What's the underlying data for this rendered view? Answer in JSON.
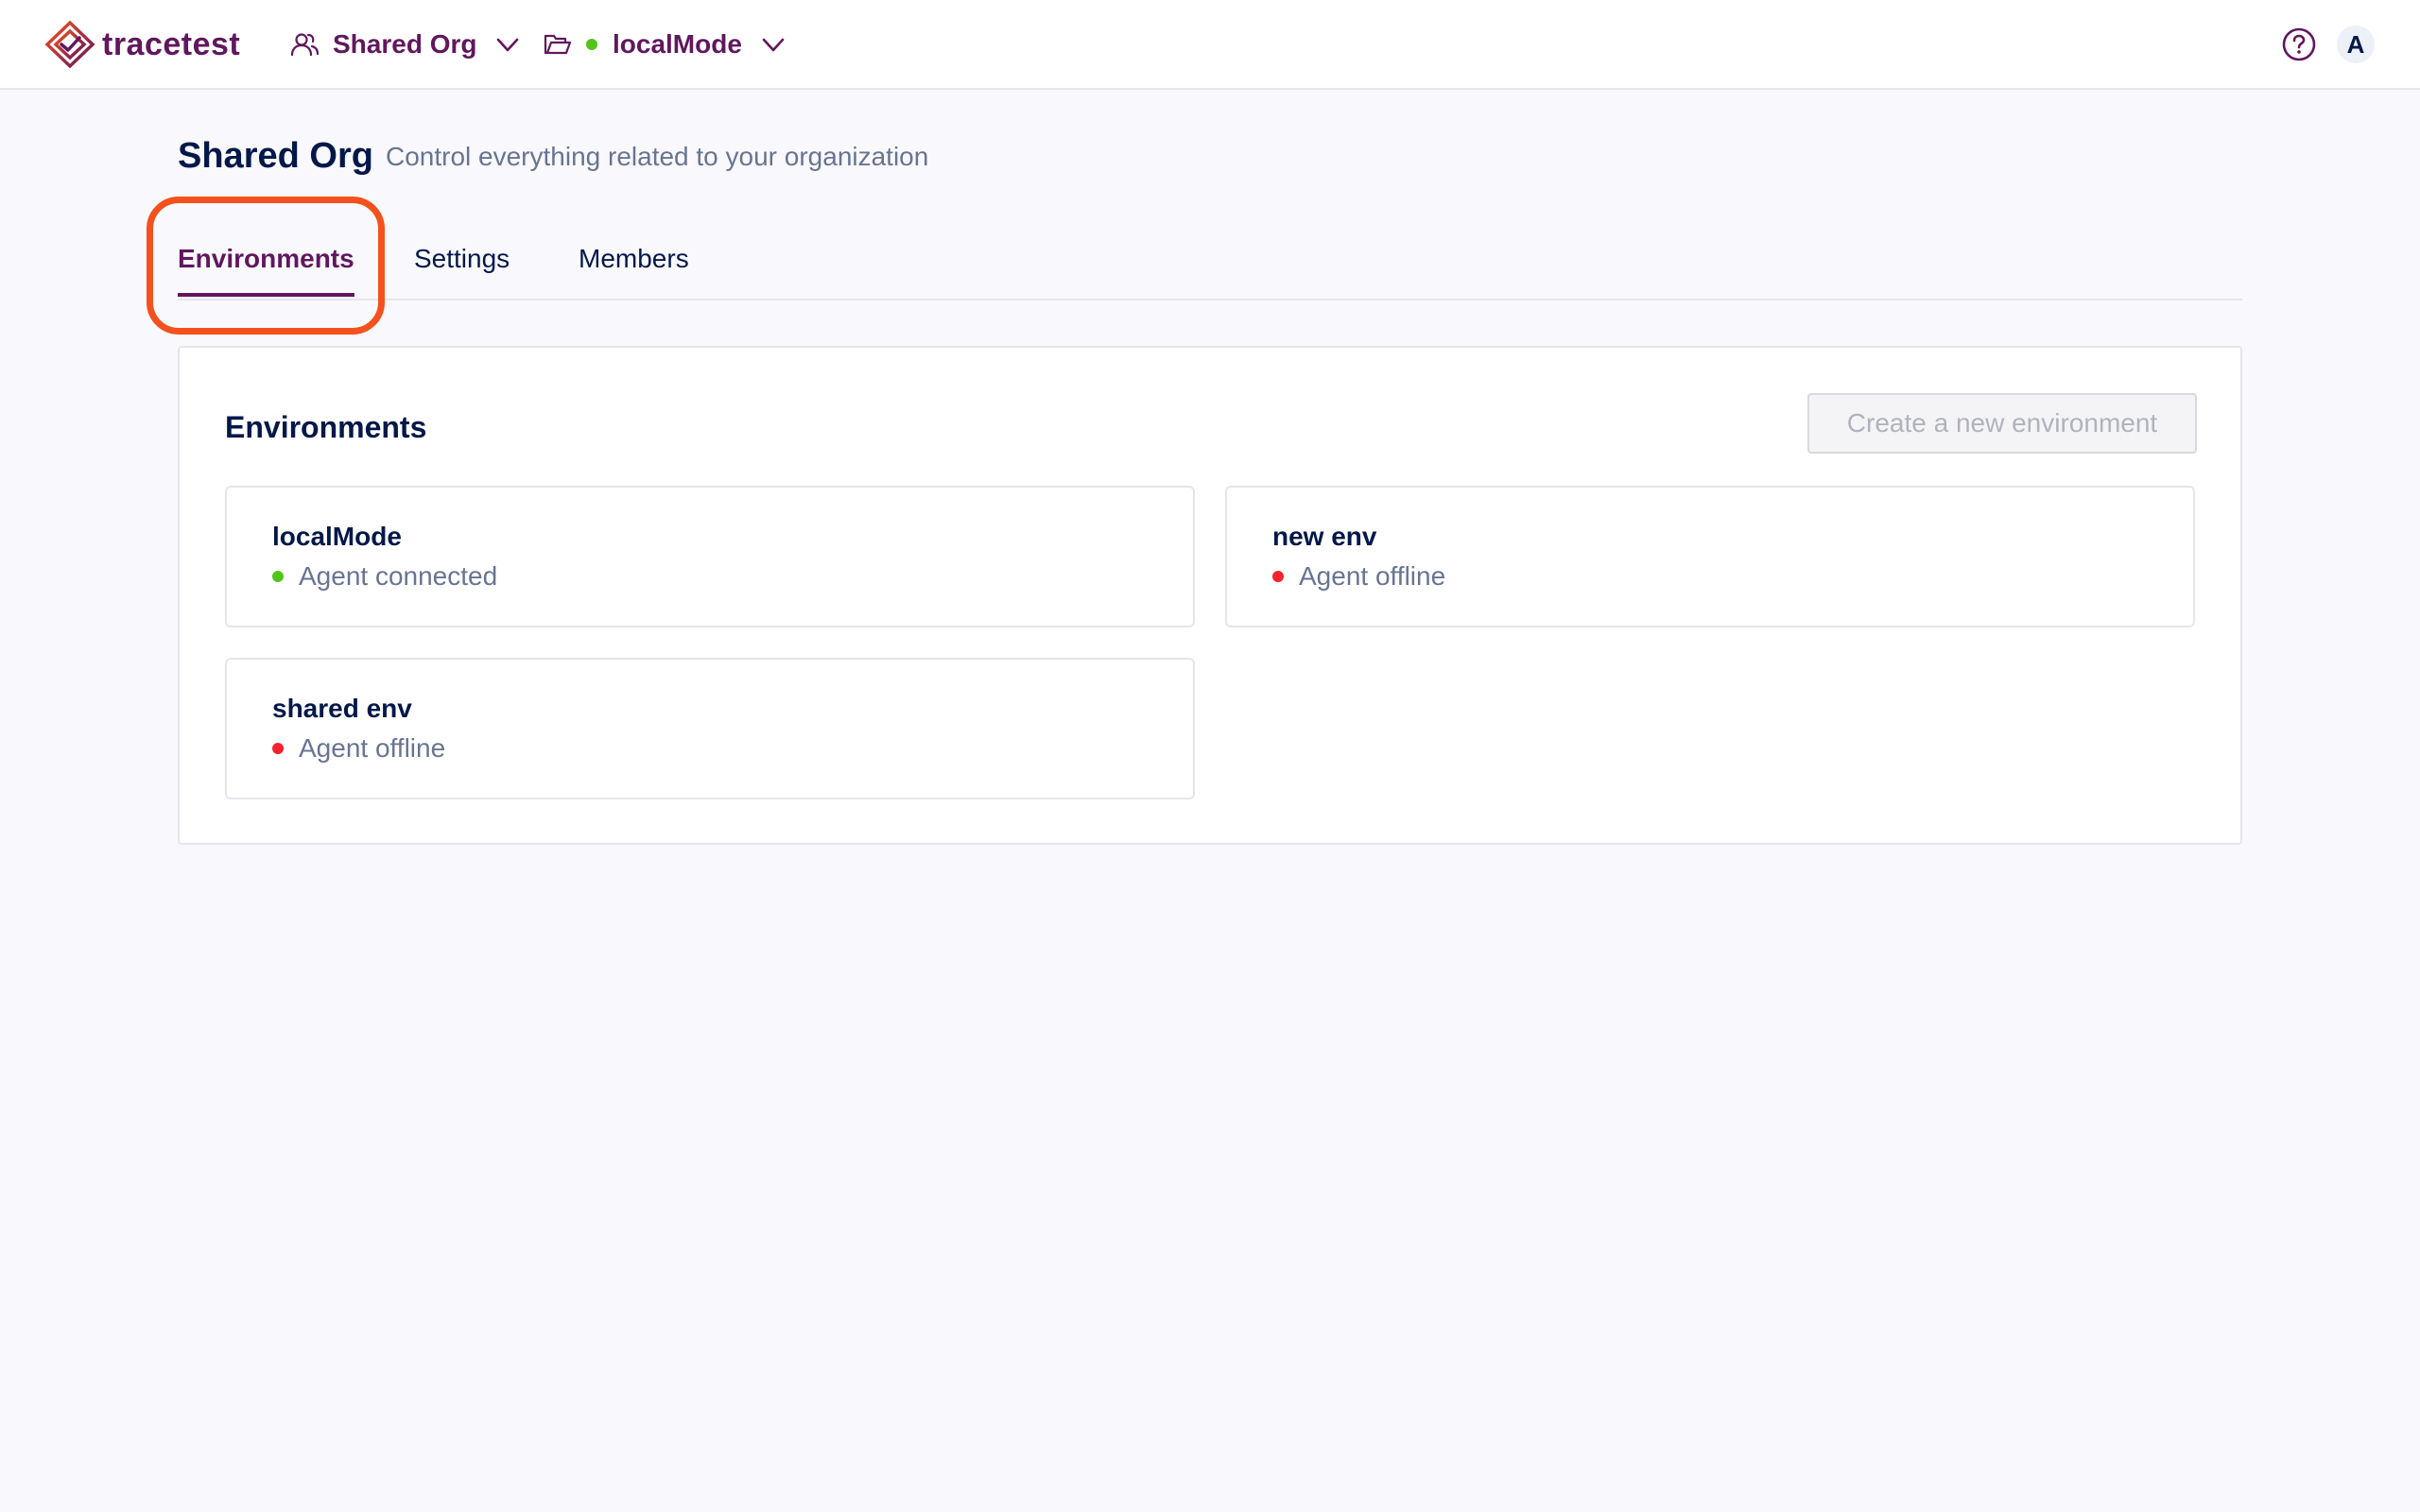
{
  "topbar": {
    "logo_text": "tracetest",
    "org_selector": {
      "label": "Shared Org",
      "icon": "users-icon"
    },
    "env_selector": {
      "label": "localMode",
      "icon": "folder-open-icon",
      "status_color": "#52c41a"
    },
    "help_icon": "question-circle-icon",
    "avatar_initial": "A"
  },
  "header": {
    "title": "Shared Org",
    "subtitle": "Control everything related to your organization"
  },
  "tabs": [
    {
      "label": "Environments",
      "active": true
    },
    {
      "label": "Settings",
      "active": false
    },
    {
      "label": "Members",
      "active": false
    }
  ],
  "environments_panel": {
    "title": "Environments",
    "create_button_label": "Create a new environment",
    "environments": [
      {
        "name": "localMode",
        "status": "Agent connected",
        "status_color": "#52c41a"
      },
      {
        "name": "new env",
        "status": "Agent offline",
        "status_color": "#f5222d"
      },
      {
        "name": "shared env",
        "status": "Agent offline",
        "status_color": "#f5222d"
      }
    ]
  },
  "colors": {
    "brand": "#61175e",
    "text": "#031849",
    "muted": "#687492",
    "highlight": "#f4511e",
    "online": "#52c41a",
    "offline": "#f5222d"
  }
}
